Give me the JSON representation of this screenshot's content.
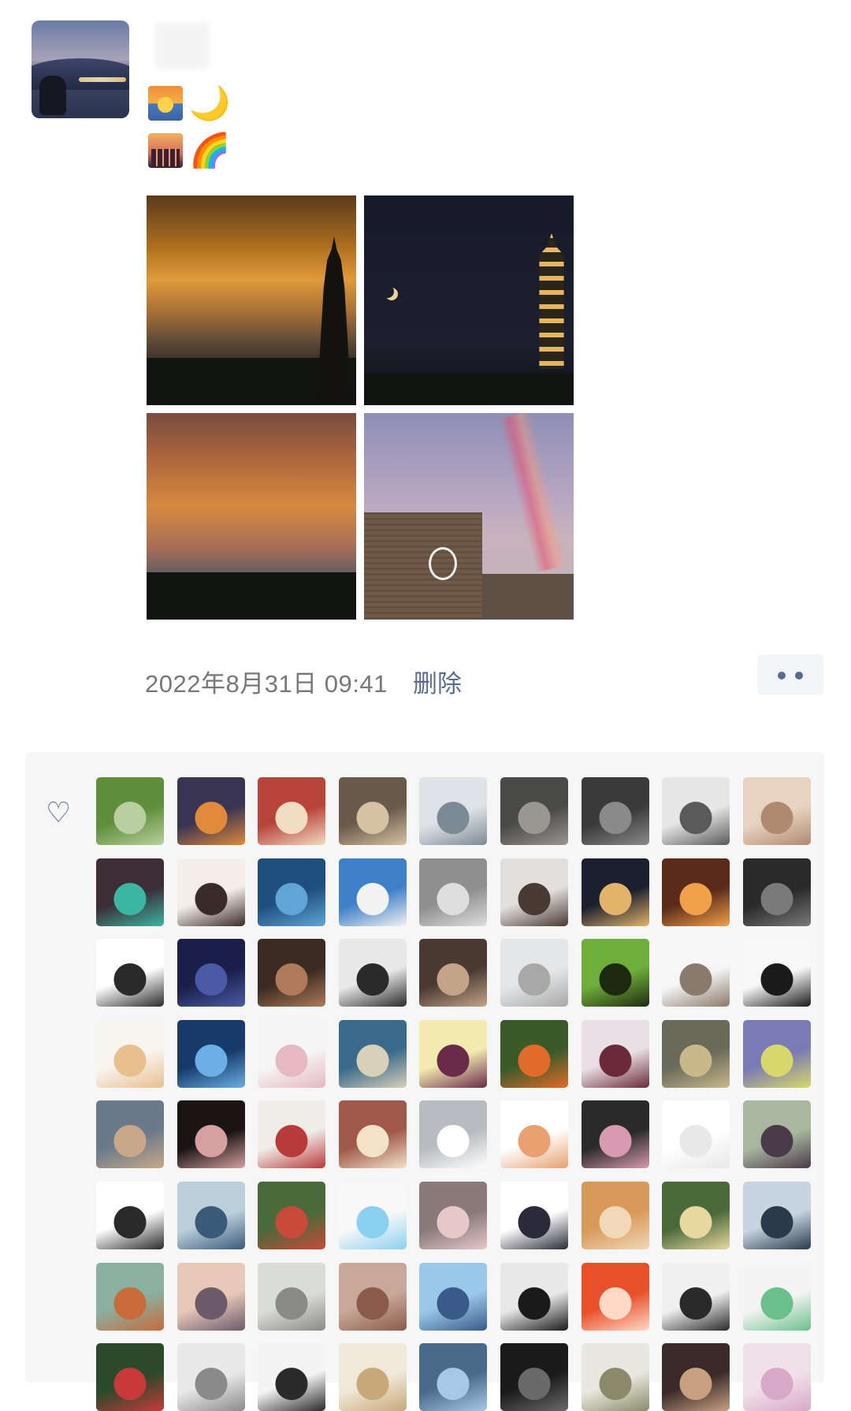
{
  "post": {
    "emoji_row1": [
      "sunrise-icon",
      "🌙"
    ],
    "emoji_row2": [
      "city-sunset-icon",
      "🌈"
    ],
    "timestamp": "2022年8月31日 09:41",
    "delete_label": "删除",
    "accent_color": "#576b95"
  },
  "likes": {
    "icon": "heart-icon",
    "avatar_rows": 8,
    "avatar_cols": 9
  }
}
